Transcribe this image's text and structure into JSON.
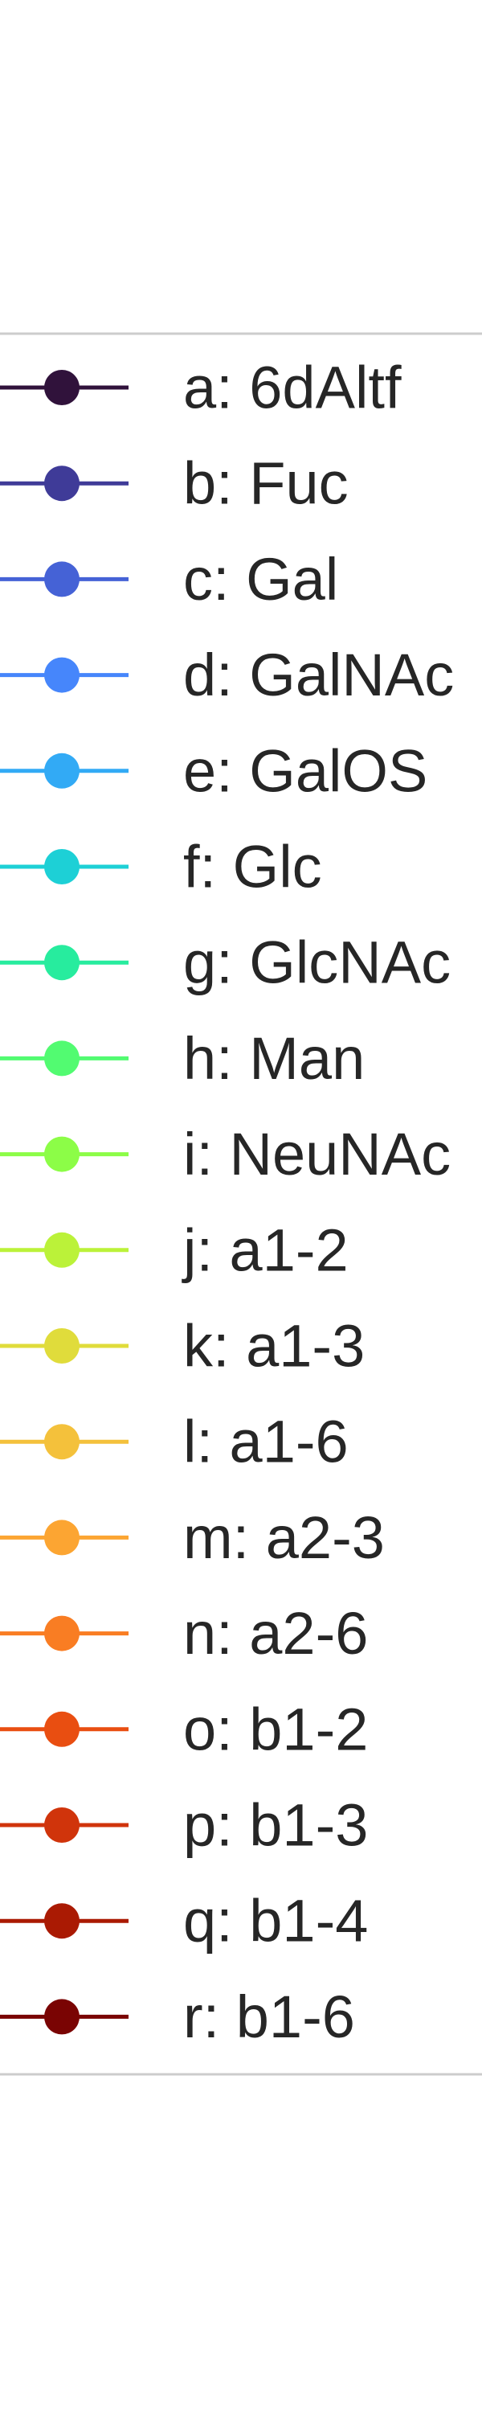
{
  "chart_data": {
    "type": "line",
    "legend": {
      "placement": "right",
      "frame_color": "#cccccc",
      "text_color": "#262626",
      "entries": [
        {
          "label": "a: 6dAltf",
          "color": "#30123b"
        },
        {
          "label": "b: Fuc",
          "color": "#3f3b98"
        },
        {
          "label": "c: Gal",
          "color": "#4562d6"
        },
        {
          "label": "d: GalNAc",
          "color": "#4686fb"
        },
        {
          "label": "e: GalOS",
          "color": "#32aaf5"
        },
        {
          "label": "f: Glc",
          "color": "#1dd0d6"
        },
        {
          "label": "g: GlcNAc",
          "color": "#27ec9e"
        },
        {
          "label": "h: Man",
          "color": "#52fb71"
        },
        {
          "label": "i: NeuNAc",
          "color": "#8cfd47"
        },
        {
          "label": "j: a1-2",
          "color": "#bbf239"
        },
        {
          "label": "k: a1-3",
          "color": "#e0dc3b"
        },
        {
          "label": "l: a1-6",
          "color": "#f4c13b"
        },
        {
          "label": "m: a2-3",
          "color": "#fca532"
        },
        {
          "label": "n: a2-6",
          "color": "#f97d23"
        },
        {
          "label": "o: b1-2",
          "color": "#e94e11"
        },
        {
          "label": "p: b1-3",
          "color": "#d0340b"
        },
        {
          "label": "q: b1-4",
          "color": "#aa1a03"
        },
        {
          "label": "r: b1-6",
          "color": "#7a0403"
        }
      ]
    }
  }
}
